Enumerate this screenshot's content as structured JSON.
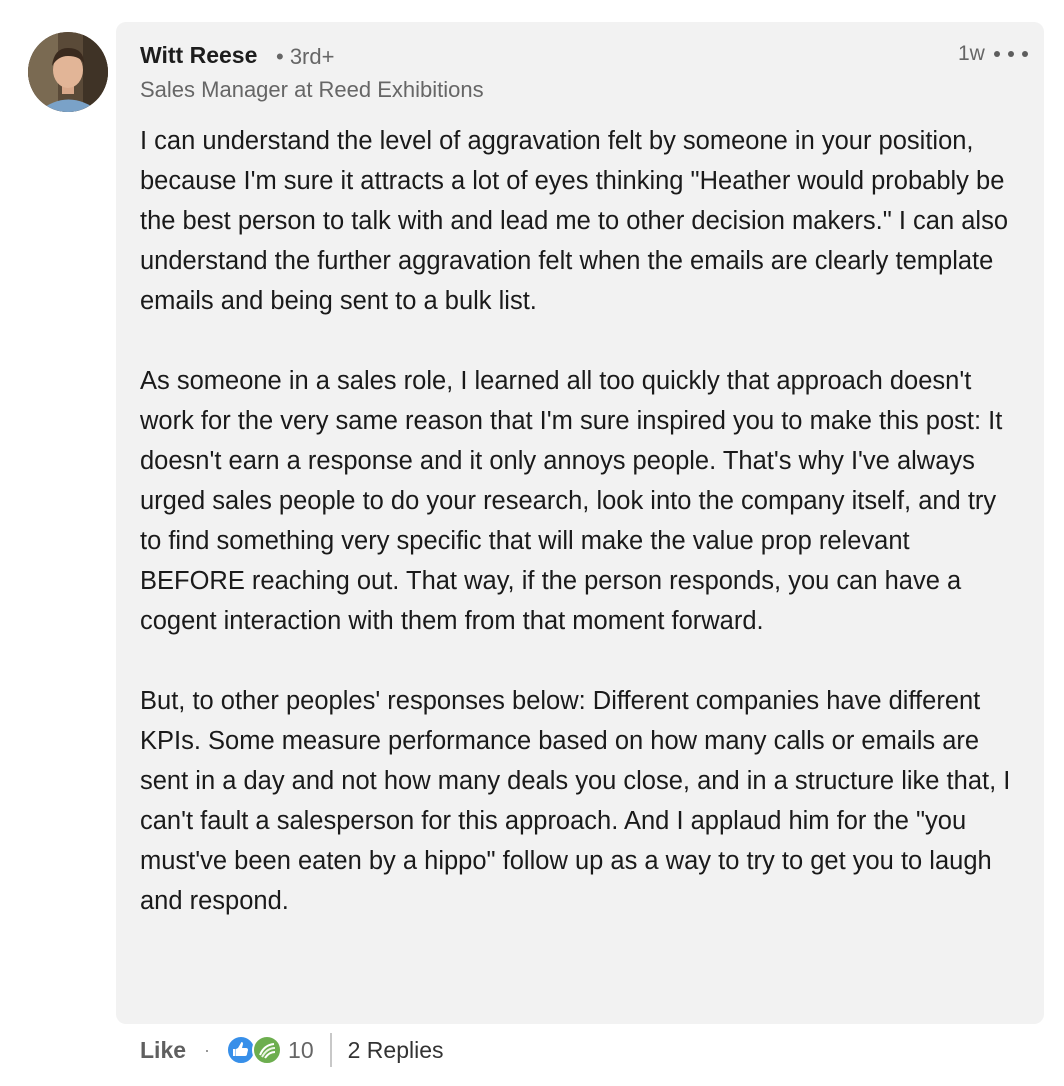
{
  "comment": {
    "author_name": "Witt Reese",
    "degree": "• 3rd+",
    "headline": "Sales Manager at Reed Exhibitions",
    "timestamp": "1w",
    "menu_icon": "ellipsis-icon",
    "paragraphs": [
      "I can understand the level of aggravation felt by someone in your position, because I'm sure it attracts a lot of eyes thinking \"Heather would probably be the best person to talk with and lead me to other decision makers.\" I can also understand the further aggravation felt when the emails are clearly template emails and being sent to a bulk list.",
      "As someone in a sales role, I learned all too quickly that approach doesn't work for the very same reason that I'm sure inspired you to make this post: It doesn't earn a response and it only annoys people. That's why I've always urged sales people to do your research, look into the company itself, and try to find something very specific that will make the value prop relevant BEFORE reaching out. That way, if the person responds, you can have a cogent interaction with them from that moment forward.",
      "But, to other peoples' responses below: Different companies have different KPIs. Some measure performance based on how many calls or emails are sent in a day and not how many deals you close, and in a structure like that, I can't fault a salesperson for this approach. And I applaud him for the \"you must've been eaten by a hippo\" follow up as a way to try to get you to laugh and respond."
    ]
  },
  "actions": {
    "like_label": "Like",
    "separator": "·",
    "reaction_icons": [
      "like-reaction-icon",
      "support-reaction-icon"
    ],
    "reaction_count": "10",
    "replies_label": "2 Replies"
  },
  "colors": {
    "bubble": "#f2f2f2",
    "like_blue": "#378fe9",
    "support_green": "#6dae4f"
  }
}
